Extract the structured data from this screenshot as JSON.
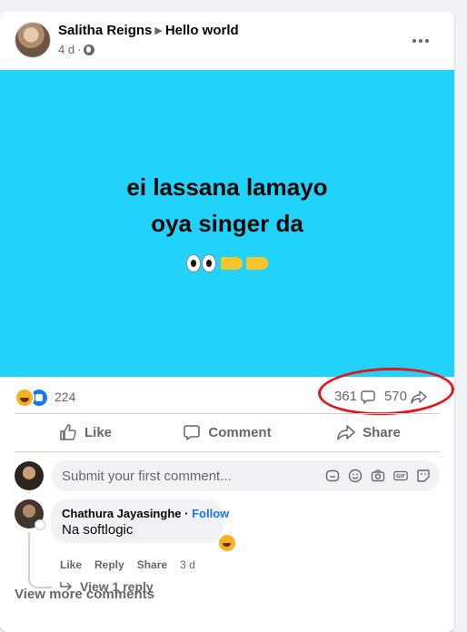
{
  "post": {
    "author": "Salitha Reigns",
    "group": "Hello world",
    "time": "4 d",
    "time_separator": "·",
    "text_line1": "ei lassana lamayo",
    "text_line2": "oya singer da",
    "background_color": "#21d3fb"
  },
  "stats": {
    "reaction_count": "224",
    "comment_count": "361",
    "share_count": "570",
    "highlight_color": "#e0161f"
  },
  "actions": {
    "like": "Like",
    "comment": "Comment",
    "share": "Share"
  },
  "composer": {
    "placeholder": "Submit your first comment..."
  },
  "comment": {
    "author": "Chathura Jayasinghe",
    "follow_separator": "·",
    "follow": "Follow",
    "text": "Na softlogic",
    "like": "Like",
    "reply": "Reply",
    "share": "Share",
    "time": "3 d",
    "view_replies": "View 1 reply"
  },
  "footer": {
    "view_more": "View more comments"
  },
  "colors": {
    "accent": "#1877f2",
    "secondary_text": "#65676b",
    "page_bg": "#f0f2f5"
  }
}
